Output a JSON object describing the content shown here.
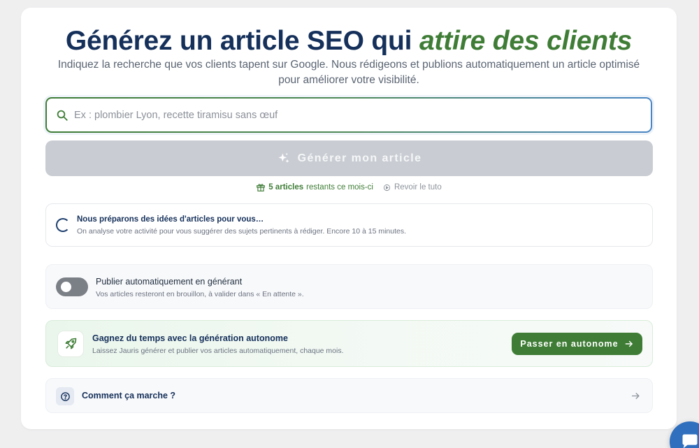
{
  "header": {
    "title_main": "Générez un article SEO qui",
    "title_accent": "attire des clients",
    "subtitle": "Indiquez la recherche que vos clients tapent sur Google. Nous rédigeons et publions automatiquement un article optimisé pour améliorer votre visibilité."
  },
  "search": {
    "placeholder": "Ex : plombier Lyon, recette tiramisu sans œuf",
    "value": "",
    "icon": "search-icon"
  },
  "generate_button": {
    "label": "Générer mon article",
    "icon": "sparkles-icon"
  },
  "quota": {
    "icon": "gift-icon",
    "count": "5 articles",
    "rest": "restants ce mois-ci",
    "tutorial_icon": "play-circle-icon",
    "tutorial": "Revoir le tuto"
  },
  "preparing": {
    "title": "Nous préparons des idées d'articles pour vous…",
    "description": "On analyse votre activité pour vous suggérer des sujets pertinents à rédiger. Encore 10 à 15 minutes."
  },
  "auto_publish": {
    "enabled": false,
    "title": "Publier automatiquement en générant",
    "description": "Vos articles resteront en brouillon, à valider dans « En attente »."
  },
  "autonomous": {
    "icon": "rocket-icon",
    "title": "Gagnez du temps avec la génération autonome",
    "description": "Laissez Jauris générer et publier vos articles automatiquement, chaque mois.",
    "button": "Passer en autonome",
    "button_icon": "arrow-right-icon"
  },
  "how_it_works": {
    "label": "Comment ça marche ?",
    "icon": "question-circle-icon",
    "arrow_icon": "arrow-right-icon"
  },
  "chat": {
    "icon": "chat-bubble-icon"
  },
  "colors": {
    "primary_navy": "#15305a",
    "accent_green": "#3f7d36",
    "accent_blue": "#4a86c5",
    "disabled_button": "#c9cdd3"
  }
}
